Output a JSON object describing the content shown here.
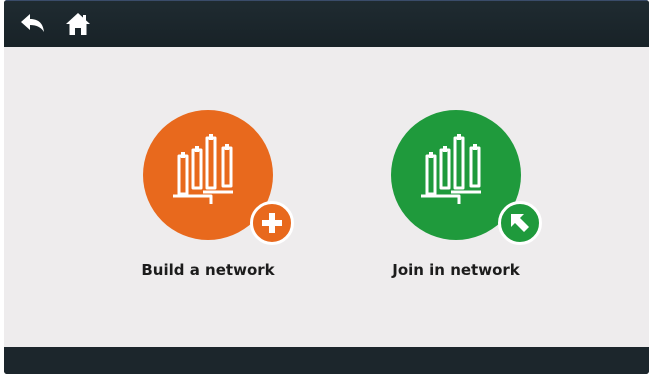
{
  "toolbar": {
    "back_icon": "back-arrow-icon",
    "home_icon": "home-icon"
  },
  "colors": {
    "build_accent": "#e8691d",
    "join_accent": "#1f9a3c",
    "topbar": "#1b252b",
    "content_bg": "#eeeced"
  },
  "options": [
    {
      "label": "Build a network",
      "icon": "network-devices-icon",
      "badge_icon": "plus-icon"
    },
    {
      "label": "Join in network",
      "icon": "network-devices-icon",
      "badge_icon": "arrow-up-left-icon"
    }
  ]
}
